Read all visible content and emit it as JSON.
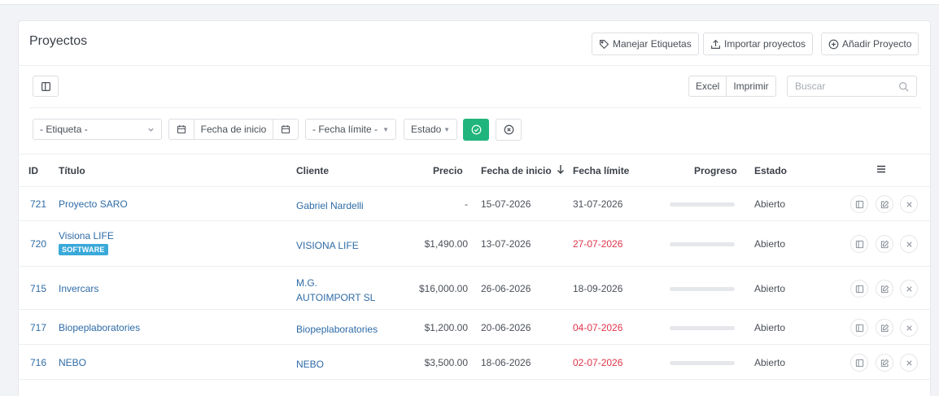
{
  "header": {
    "title": "Proyectos",
    "manage_labels": "Manejar Etiquetas",
    "import_projects": "Importar proyectos",
    "add_project": "Añadir Proyecto"
  },
  "toolbar": {
    "excel": "Excel",
    "print": "Imprimir",
    "search_placeholder": "Buscar"
  },
  "filters": {
    "label": "- Etiqueta -",
    "start_date": "Fecha de inicio",
    "deadline": "- Fecha límite -",
    "status": "Estado"
  },
  "table": {
    "columns": {
      "id": "ID",
      "title": "Título",
      "client": "Cliente",
      "price": "Precio",
      "start": "Fecha de inicio",
      "deadline": "Fecha límite",
      "progress": "Progreso",
      "status": "Estado"
    },
    "rows": [
      {
        "id": "721",
        "title": "Proyecto SARO",
        "tag": "",
        "client_1": "Gabriel Nardelli",
        "client_2": "",
        "price": "-",
        "start": "15-07-2026",
        "deadline": "31-07-2026",
        "deadline_overdue": false,
        "progress": 0,
        "status": "Abierto"
      },
      {
        "id": "720",
        "title": "Visiona LIFE",
        "tag": "SOFTWARE",
        "client_1": "VISIONA LIFE",
        "client_2": "",
        "price": "$1,490.00",
        "start": "13-07-2026",
        "deadline": "27-07-2026",
        "deadline_overdue": true,
        "progress": 0,
        "status": "Abierto"
      },
      {
        "id": "715",
        "title": "Invercars",
        "tag": "",
        "client_1": "M.G.",
        "client_2": "AUTOIMPORT SL",
        "price": "$16,000.00",
        "start": "26-06-2026",
        "deadline": "18-09-2026",
        "deadline_overdue": false,
        "progress": 0,
        "status": "Abierto"
      },
      {
        "id": "717",
        "title": "Biopeplaboratories",
        "tag": "",
        "client_1": "Biopeplaboratories",
        "client_2": "",
        "price": "$1,200.00",
        "start": "20-06-2026",
        "deadline": "04-07-2026",
        "deadline_overdue": true,
        "progress": 0,
        "status": "Abierto"
      },
      {
        "id": "716",
        "title": "NEBO",
        "tag": "",
        "client_1": "NEBO",
        "client_2": "",
        "price": "$3,500.00",
        "start": "18-06-2026",
        "deadline": "02-07-2026",
        "deadline_overdue": true,
        "progress": 0,
        "status": "Abierto"
      }
    ]
  },
  "colors": {
    "link": "#2e6ba6",
    "overdue": "#e0344a",
    "apply": "#20b57c",
    "tag": "#3aa9d9"
  }
}
